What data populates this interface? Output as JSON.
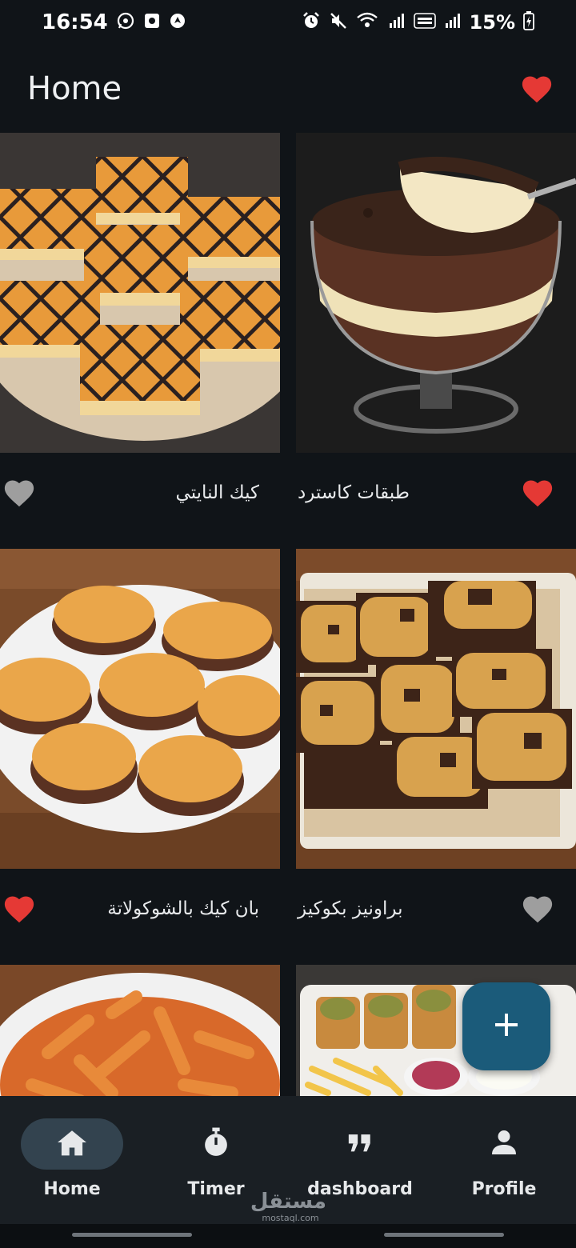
{
  "status_bar": {
    "time": "16:54",
    "battery": "15%"
  },
  "header": {
    "title": "Home"
  },
  "colors": {
    "heart_active": "#e53935",
    "heart_inactive": "#9e9e9e",
    "fab": "#1b5b7a",
    "nav_active": "#33434f"
  },
  "recipes": [
    {
      "title": "كيك النايتي",
      "favorite": false
    },
    {
      "title": "طبقات كاسترد",
      "favorite": true
    },
    {
      "title": "بان كيك بالشوكولاتة",
      "favorite": true
    },
    {
      "title": "براونيز بكوكيز",
      "favorite": false
    }
  ],
  "fab": {
    "icon": "plus-icon"
  },
  "nav": {
    "items": [
      {
        "label": "Home",
        "icon": "home-icon",
        "active": true
      },
      {
        "label": "Timer",
        "icon": "stopwatch-icon",
        "active": false
      },
      {
        "label": "dashboard",
        "icon": "quote-icon",
        "active": false
      },
      {
        "label": "Profile",
        "icon": "person-icon",
        "active": false
      }
    ]
  },
  "watermark": {
    "arabic": "مستقل",
    "latin": "mostaql.com"
  }
}
